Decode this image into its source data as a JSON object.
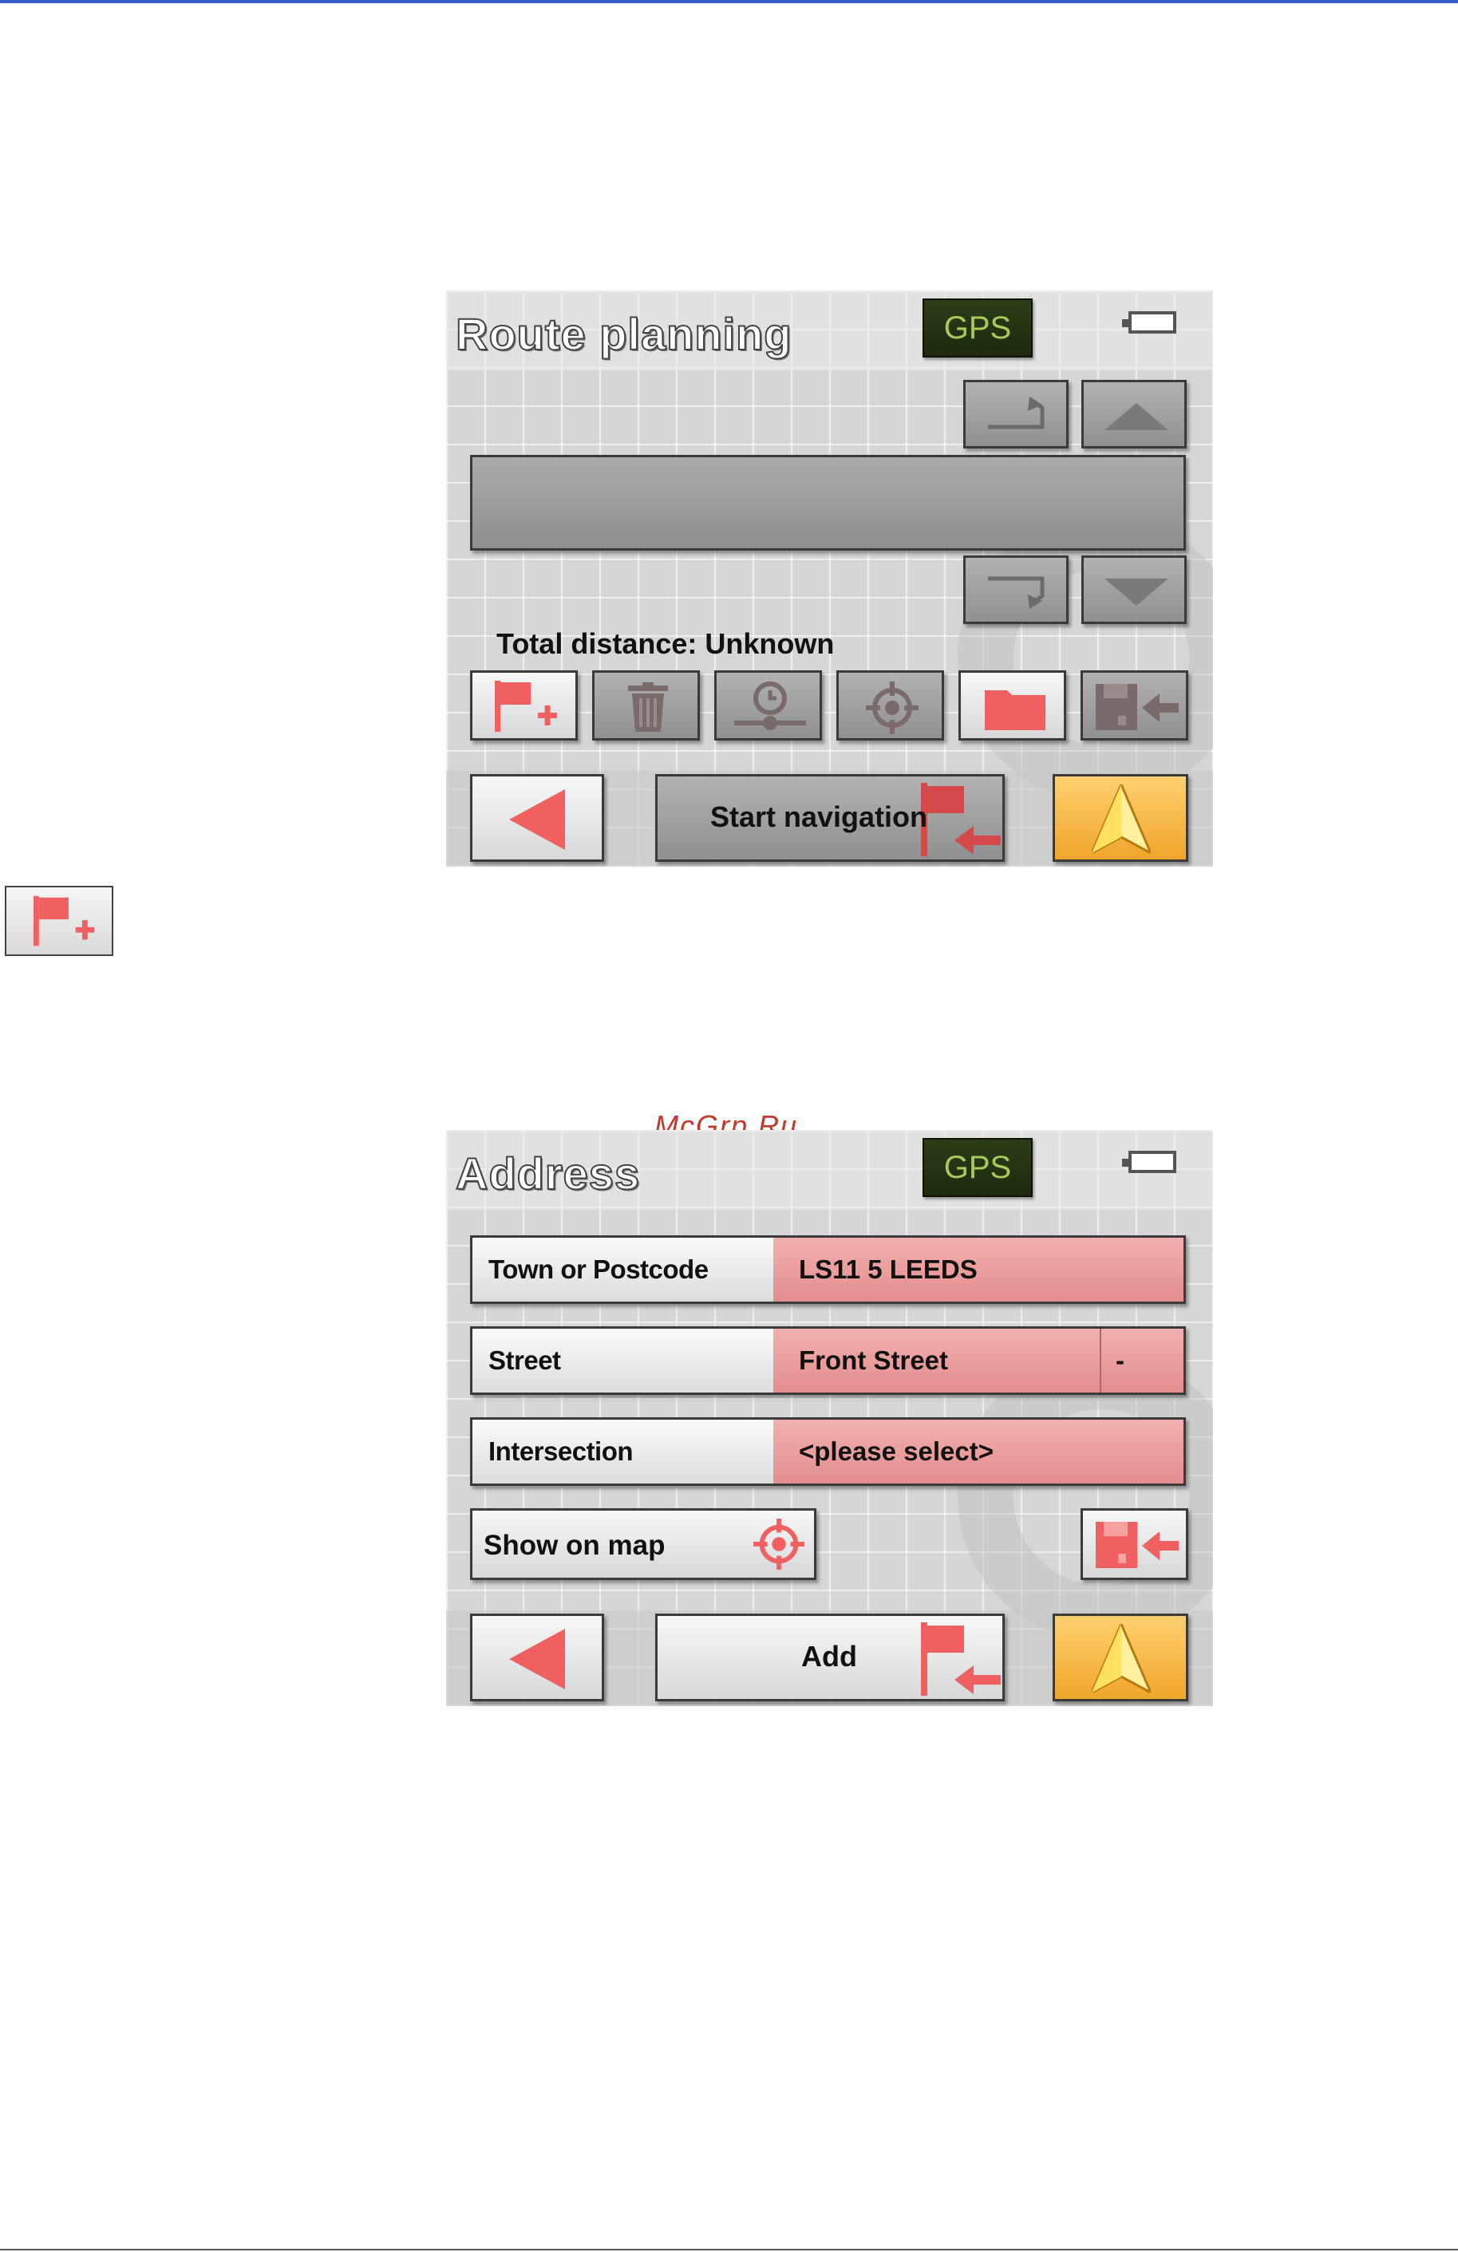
{
  "screens": {
    "route_planning": {
      "title": "Route planning",
      "gps_label": "GPS",
      "total_distance": "Total distance: Unknown",
      "start_navigation": "Start navigation"
    },
    "address": {
      "title": "Address",
      "gps_label": "GPS",
      "fields": [
        {
          "label": "Town or Postcode",
          "value": "LS11 5 LEEDS"
        },
        {
          "label": "Street",
          "value": "Front Street",
          "suffix": "-"
        },
        {
          "label": "Intersection",
          "value": "<please select>"
        }
      ],
      "show_on_map": "Show on map",
      "add": "Add"
    }
  },
  "watermark": "McGrp.Ru",
  "colors": {
    "accent_red": "#f06060",
    "gps_text": "#a9c95a",
    "orange": "#f0a52a",
    "field_pink": "#e9a0a0"
  },
  "icons": [
    "add-waypoint-icon",
    "delete-icon",
    "options-icon",
    "crosshair-icon",
    "folder-icon",
    "save-icon",
    "back-arrow-icon",
    "navigation-arrow-icon",
    "flag-arrow-icon",
    "undo-icon",
    "redo-icon",
    "scroll-up-icon",
    "scroll-down-icon",
    "battery-icon"
  ]
}
